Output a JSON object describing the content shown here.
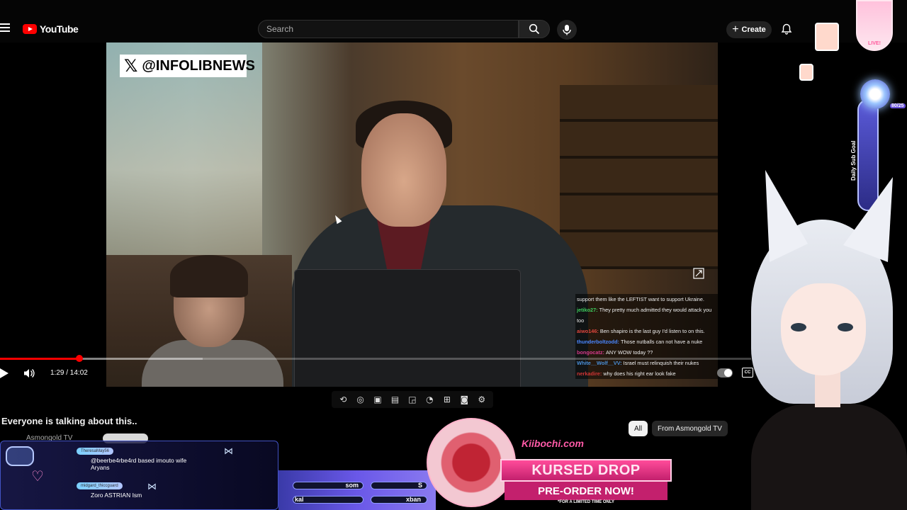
{
  "header": {
    "logo_text": "YouTube",
    "search_placeholder": "Search",
    "create_label": "Create"
  },
  "video": {
    "watermark": "@INFOLIBNEWS",
    "current_time_display": "1:29 / 14:02",
    "progress_fraction": 0.106,
    "buffered_fraction": 0.27,
    "overlay_chat": [
      {
        "user": "",
        "text": "support them like the LEFTIST want to support Ukraine.",
        "color": "#ffffff"
      },
      {
        "user": "jetiko27:",
        "text": "They pretty much admitted they would attack you too",
        "color": "#3ecf5f"
      },
      {
        "user": "aiwo146:",
        "text": "Ben shapiro is the last guy I'd listen to on this.",
        "color": "#e0463c"
      },
      {
        "user": "thunderboltzodd:",
        "text": "Those nutballs can not have a nuke",
        "color": "#4a87ff"
      },
      {
        "user": "bongocatz:",
        "text": "ANY WOW today ??",
        "color": "#d33a8a"
      },
      {
        "user": "White__Wolf__VV:",
        "text": "Israel must relinquish their nukes",
        "color": "#4a8fd8"
      },
      {
        "user": "nerkadire:",
        "text": "why does his right ear look fake",
        "color": "#d13535"
      }
    ]
  },
  "below": {
    "title": "Everyone is talking about this..",
    "channel": "Asmongold TV",
    "chips": [
      "All",
      "From Asmongold TV"
    ]
  },
  "stream_chat": [
    {
      "tag": "TheresaMay56",
      "message_1": "@beerbe4rbe4rd based imouto wife",
      "message_2": "Aryans"
    },
    {
      "tag": "midgard_thiccguard",
      "message_1": "Zoro ASTRIAN Ism",
      "message_2": ""
    }
  ],
  "goal_bars": [
    "som",
    "S",
    "kal",
    "xban"
  ],
  "promo": {
    "brand": "Kiibochi.com",
    "title": "KURSED DROP",
    "subtitle": "PRE-ORDER NOW!",
    "note": "*FOR A LIMITED TIME ONLY"
  },
  "right_overlay": {
    "live": "LIVE!",
    "goal_label": "Daily Sub Goal",
    "goal_count": "80/25"
  },
  "icons": [
    "menu-icon",
    "search-icon",
    "mic-icon",
    "plus-icon",
    "bell-icon",
    "play-icon",
    "volume-icon",
    "cc-icon",
    "expand-icon",
    "x-logo-icon",
    "loop-icon",
    "broadcast-icon",
    "tv-icon",
    "clapper-icon",
    "resize-icon",
    "speed-icon",
    "add-box-icon",
    "camera-icon",
    "gear-icon",
    "bow-icon",
    "heart-icon"
  ],
  "colors": {
    "accent": "#ff0000",
    "background": "#000000",
    "promo_pink": "#ff4c9a"
  }
}
